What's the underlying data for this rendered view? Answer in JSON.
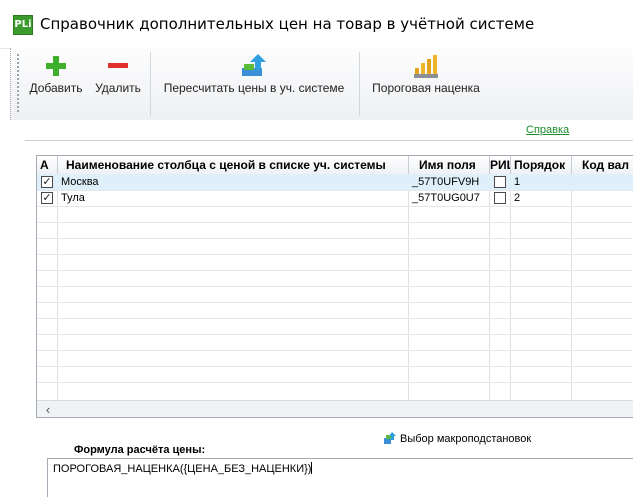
{
  "window": {
    "title": "Справочник дополнительных цен на товар в учётной системе",
    "app_icon_text": "PLi"
  },
  "toolbar": {
    "add_label": "Добавить",
    "delete_label": "Удалить",
    "recalc_label": "Пересчитать цены в уч. системе",
    "markup_label": "Пороговая наценка"
  },
  "help": {
    "label": "Справка"
  },
  "grid": {
    "columns": [
      "А",
      "Наименование столбца с ценой в списке уч. системы",
      "Имя поля",
      "РИЦ",
      "Порядок",
      "Код вал"
    ],
    "rows": [
      {
        "active": true,
        "name": "Москва",
        "field": "_57T0UFV9H",
        "ric": false,
        "order": "1",
        "currency": ""
      },
      {
        "active": true,
        "name": "Тула",
        "field": "_57T0UG0U7",
        "ric": false,
        "order": "2",
        "currency": ""
      }
    ],
    "selected_row": 0
  },
  "macro": {
    "label": "Выбор макроподстановок"
  },
  "formula": {
    "label": "Формула расчёта цены:",
    "value": "ПОРОГОВАЯ_НАЦЕНКА({ЦЕНА_БЕЗ_НАЦЕНКИ})"
  },
  "colors": {
    "selected_row": "#dff0fb",
    "link_green": "#1f8d2e",
    "add_green": "#3fae2a",
    "delete_red": "#e0302a"
  }
}
